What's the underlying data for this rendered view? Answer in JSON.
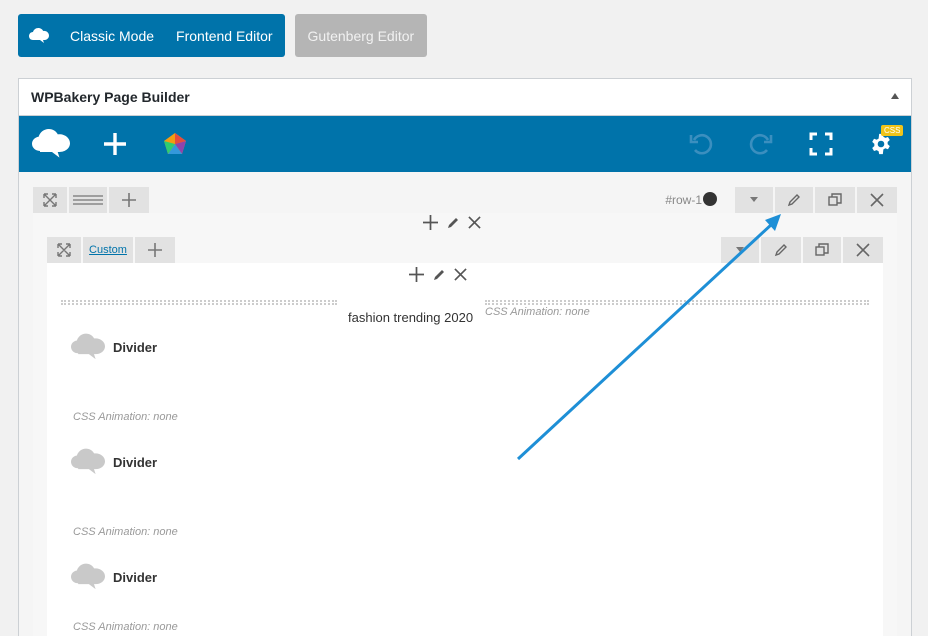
{
  "mode_bar": {
    "classic_label": "Classic Mode",
    "frontend_label": "Frontend Editor",
    "gutenberg_label": "Gutenberg Editor"
  },
  "panel": {
    "title": "WPBakery Page Builder"
  },
  "toolbar": {
    "css_badge": "CSS"
  },
  "row": {
    "id_label": "#row-1"
  },
  "inner_row": {
    "custom_label": "Custom"
  },
  "separator": {
    "title": "fashion trending 2020",
    "animation": "CSS Animation: none"
  },
  "elements": [
    {
      "name": "Divider",
      "animation": "CSS Animation: none"
    },
    {
      "name": "Divider",
      "animation": "CSS Animation: none"
    },
    {
      "name": "Divider",
      "animation": "CSS Animation: none"
    }
  ],
  "colors": {
    "brand_blue": "#0073aa",
    "arrow": "#1e8fd6",
    "badge": "#f0c419"
  }
}
